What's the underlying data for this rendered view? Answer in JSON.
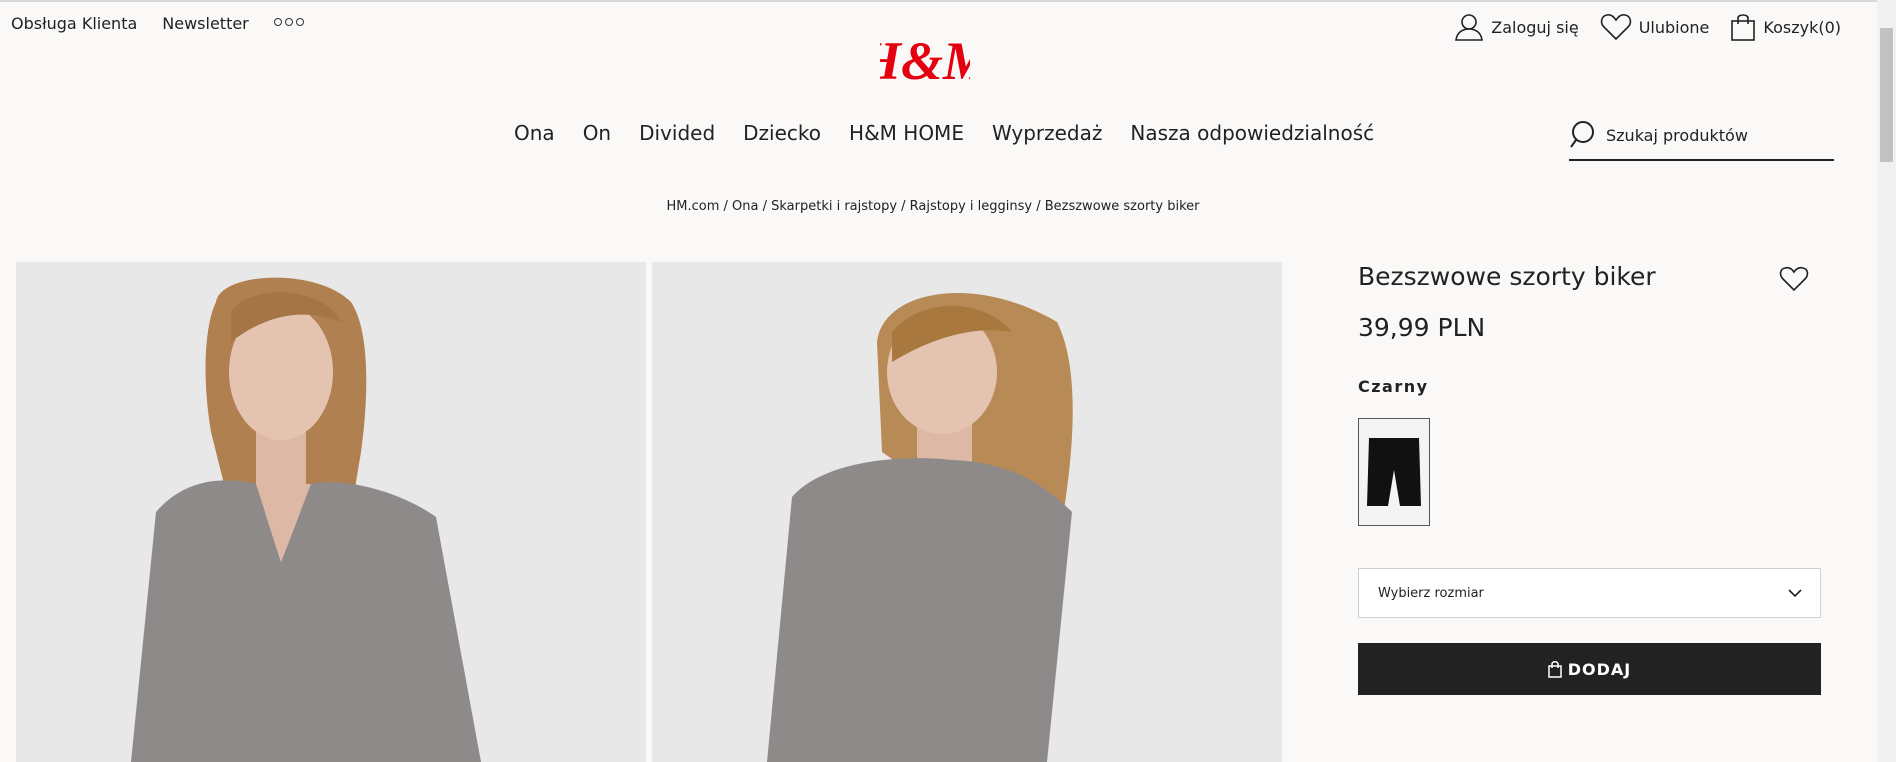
{
  "util_links": {
    "customer_service": "Obsługa Klienta",
    "newsletter": "Newsletter"
  },
  "brand": {
    "logo_text": "H&M",
    "color": "#e50010"
  },
  "account": {
    "login": "Zaloguj się",
    "favorites": "Ulubione",
    "cart": "Koszyk(0)"
  },
  "nav": [
    "Ona",
    "On",
    "Divided",
    "Dziecko",
    "H&M HOME",
    "Wyprzedaż",
    "Nasza odpowiedzialność"
  ],
  "search": {
    "placeholder": "Szukaj produktów"
  },
  "breadcrumb": "HM.com / Ona / Skarpetki i rajstopy / Rajstopy i legginsy / Bezszwowe szorty biker",
  "product": {
    "name": "Bezszwowe szorty biker",
    "price": "39,99 PLN",
    "color_label": "Czarny",
    "size_placeholder": "Wybierz rozmiar",
    "add_button": "DODAJ"
  },
  "icons": [
    "options-icon",
    "user-icon",
    "heart-icon",
    "bag-icon",
    "search-icon",
    "chevron-down-icon"
  ],
  "colors": {
    "button_bg": "#222222",
    "page_bg": "#faf9f8"
  }
}
